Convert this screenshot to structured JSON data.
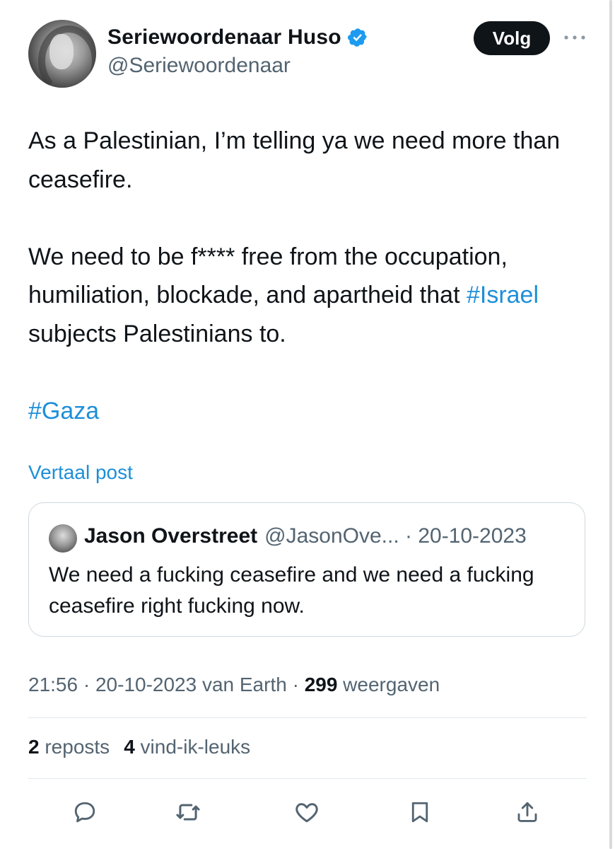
{
  "author": {
    "display_name": "Seriewoordenaar Huso",
    "handle": "@Seriewoordenaar",
    "verified_icon": "verified-badge-icon",
    "follow_label": "Volg"
  },
  "tweet": {
    "line1": "As a Palestinian, I’m telling ya we need more than ceasefire.",
    "line2_pre": "We need to be f**** free from the occupation, humiliation, blockade, and apartheid that ",
    "line2_tag": "#Israel",
    "line2_post": " subjects Palestinians to.",
    "tag_gaza": "#Gaza",
    "translate_label": "Vertaal post"
  },
  "quote": {
    "name": "Jason Overstreet",
    "meta": "@JasonOve... · 20-10-2023",
    "text": "We need a fucking ceasefire and we need a fucking ceasefire right fucking now."
  },
  "meta": {
    "time_date": "21:56 · 20-10-2023 van Earth · ",
    "views_count": "299",
    "views_label": " weergaven"
  },
  "stats": {
    "reposts_count": "2",
    "reposts_label": " reposts",
    "likes_count": "4",
    "likes_label": " vind-ik-leuks"
  },
  "colors": {
    "link": "#1d8fd8",
    "text": "#0f1419",
    "muted": "#536471"
  }
}
